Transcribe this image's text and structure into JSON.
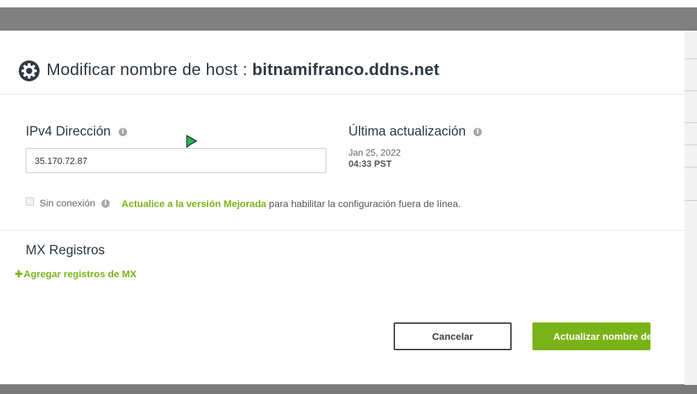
{
  "modal": {
    "title_prefix": "Modificar nombre de host",
    "title_sep": ":",
    "hostname": "bitnamifranco.ddns.net"
  },
  "ipv4": {
    "label": "IPv4 Dirección",
    "value": "35.170.72.87"
  },
  "last_update": {
    "label": "Última actualización",
    "date": "Jan 25, 2022",
    "time": "04:33 PST"
  },
  "offline": {
    "label": "Sin conexión",
    "checked": false,
    "upgrade_link": "Actualice a la versión Mejorada",
    "upgrade_text": "para habilitar la configuración fuera de línea."
  },
  "mx": {
    "heading": "MX Registros",
    "add_label": "Agregar registros de MX",
    "add_icon": "plus-icon"
  },
  "buttons": {
    "cancel": "Cancelar",
    "update": "Actualizar nombre de"
  },
  "info_icon_glyph": "i",
  "colors": {
    "accent": "#7ab317",
    "text": "#2f3a44",
    "cursor": "#2bb35a"
  }
}
